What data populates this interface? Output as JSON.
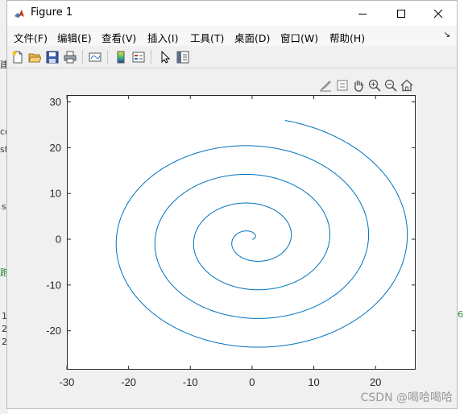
{
  "window": {
    "title": "Figure 1"
  },
  "menu": {
    "items": [
      "文件(F)",
      "编辑(E)",
      "查看(V)",
      "插入(I)",
      "工具(T)",
      "桌面(D)",
      "窗口(W)",
      "帮助(H)"
    ],
    "overflow_glyph": "↘"
  },
  "toolbar": {
    "buttons": [
      "new-figure-icon",
      "open-file-icon",
      "save-icon",
      "print-icon",
      "link-plot-icon",
      "insert-colorbar-icon",
      "insert-legend-icon",
      "edit-plot-icon",
      "property-inspector-icon"
    ]
  },
  "axes_toolbar": {
    "buttons": [
      "brush-icon",
      "data-tips-icon",
      "pan-icon",
      "zoom-in-icon",
      "zoom-out-icon",
      "restore-view-icon"
    ]
  },
  "chart_data": {
    "type": "line",
    "title": "",
    "xlabel": "",
    "ylabel": "",
    "xlim": [
      -30,
      26.5
    ],
    "ylim": [
      -28.5,
      31.5
    ],
    "xticks": [
      -30,
      -20,
      -10,
      0,
      10,
      20
    ],
    "yticks": [
      -20,
      -10,
      0,
      10,
      20,
      30
    ],
    "grid": false,
    "legend": "none",
    "series_color": "#0072BD",
    "series": [
      {
        "description": "Archimedean spiral x = t·cos(t), y = t·sin(t)",
        "t_range": [
          0,
          26.5
        ],
        "x_equation": "t*cos(t)",
        "y_equation": "t*sin(t)"
      }
    ]
  },
  "background_fragments": {
    "left": [
      "建",
      "cc",
      "st",
      "s",
      "跑",
      "1",
      "2",
      "2"
    ],
    "right": [
      "6"
    ]
  },
  "watermark": "CSDN @喝哈喝哈",
  "colors": {
    "window_bg": "#f0f0f0",
    "plot_bg": "#ffffff",
    "axis": "#262626",
    "line": "#0072BD"
  }
}
